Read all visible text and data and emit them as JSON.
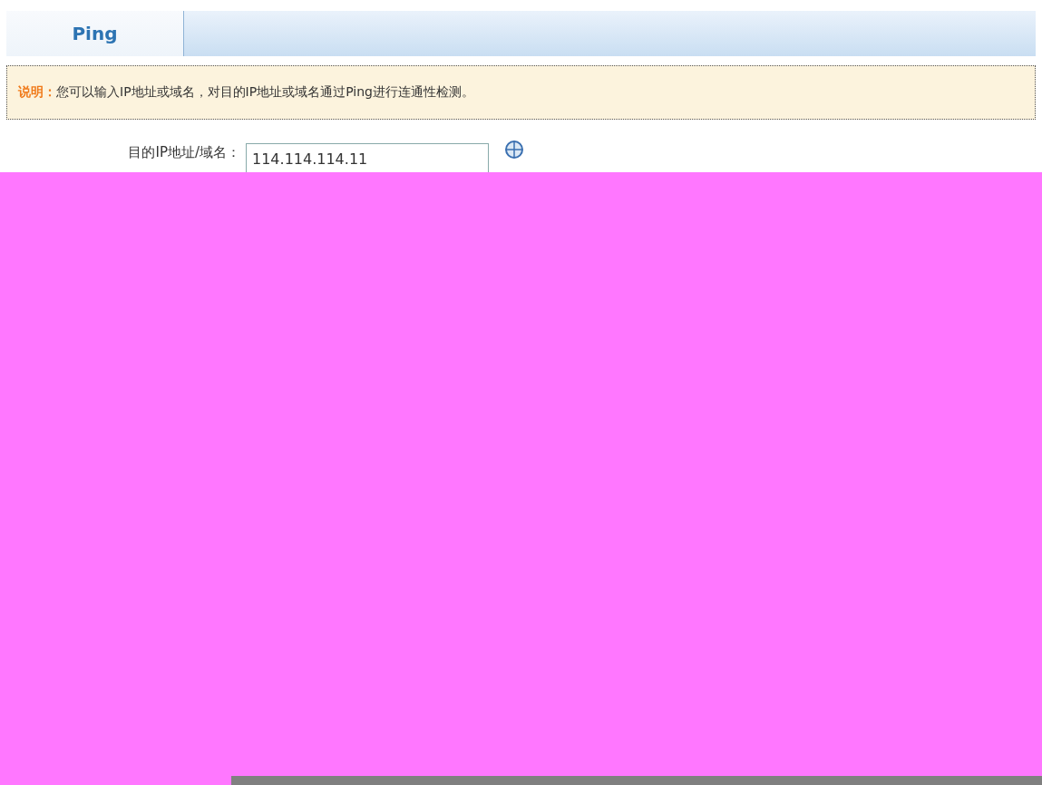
{
  "tabs": [
    {
      "label": "Ping",
      "selected": true
    }
  ],
  "notice": {
    "label": "说明：",
    "text": "您可以输入IP地址或域名，对目的IP地址或域名通过Ping进行连通性检测。"
  },
  "target_field": {
    "label": "目的IP地址/域名：",
    "value": "114.114.114.11"
  }
}
